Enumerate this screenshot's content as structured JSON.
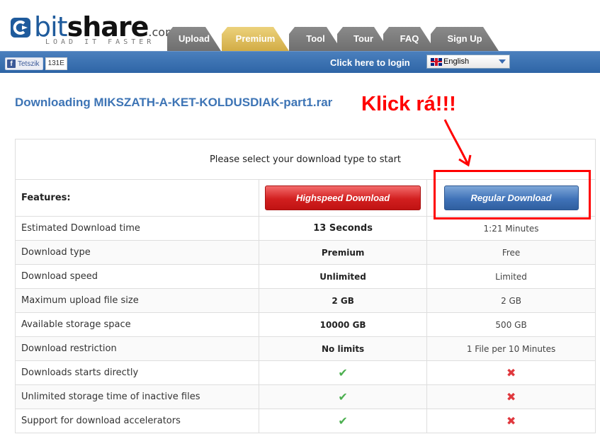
{
  "header": {
    "logo": {
      "bit": "bit",
      "share": "share",
      "dom": ".com",
      "tagline": "LOAD IT FASTER"
    },
    "tabs": [
      {
        "label": "Upload",
        "active": false
      },
      {
        "label": "Premium",
        "active": true
      },
      {
        "label": "Tool",
        "active": false
      },
      {
        "label": "Tour",
        "active": false
      },
      {
        "label": "FAQ",
        "active": false
      },
      {
        "label": "Sign Up",
        "active": false
      }
    ]
  },
  "bar": {
    "fb_like_label": "Tetszik",
    "fb_count": "131E",
    "login_link": "Click here to login",
    "language": "English"
  },
  "page": {
    "title": "Downloading MIKSZATH-A-KET-KOLDUSDIAK-part1.rar"
  },
  "annotation": {
    "text": "Klick rá!!!",
    "color": "#ff0000"
  },
  "table": {
    "header": "Please select your download type to start",
    "features_label": "Features:",
    "highspeed_button": "Highspeed Download",
    "regular_button": "Regular Download",
    "rows": [
      {
        "label": "Estimated Download time",
        "premium": "13 Seconds",
        "free": "1:21 Minutes"
      },
      {
        "label": "Download type",
        "premium": "Premium",
        "free": "Free"
      },
      {
        "label": "Download speed",
        "premium": "Unlimited",
        "free": "Limited"
      },
      {
        "label": "Maximum upload file size",
        "premium": "2 GB",
        "free": "2 GB"
      },
      {
        "label": "Available storage space",
        "premium": "10000 GB",
        "free": "500 GB"
      },
      {
        "label": "Download restriction",
        "premium": "No limits",
        "free": "1 File per 10 Minutes"
      },
      {
        "label": "Downloads starts directly",
        "premium": "✔",
        "free": "✖"
      },
      {
        "label": "Unlimited storage time of inactive files",
        "premium": "✔",
        "free": "✖"
      },
      {
        "label": "Support for download accelerators",
        "premium": "✔",
        "free": "✖"
      }
    ]
  },
  "colors": {
    "brand_blue": "#3d74b5",
    "nav_bar": "#2e65a6",
    "active_tab": "#d2ac45",
    "highspeed_button": "#d21f1f",
    "regular_button": "#3f72b8",
    "check": "#4caf50",
    "cross": "#e0383e"
  }
}
